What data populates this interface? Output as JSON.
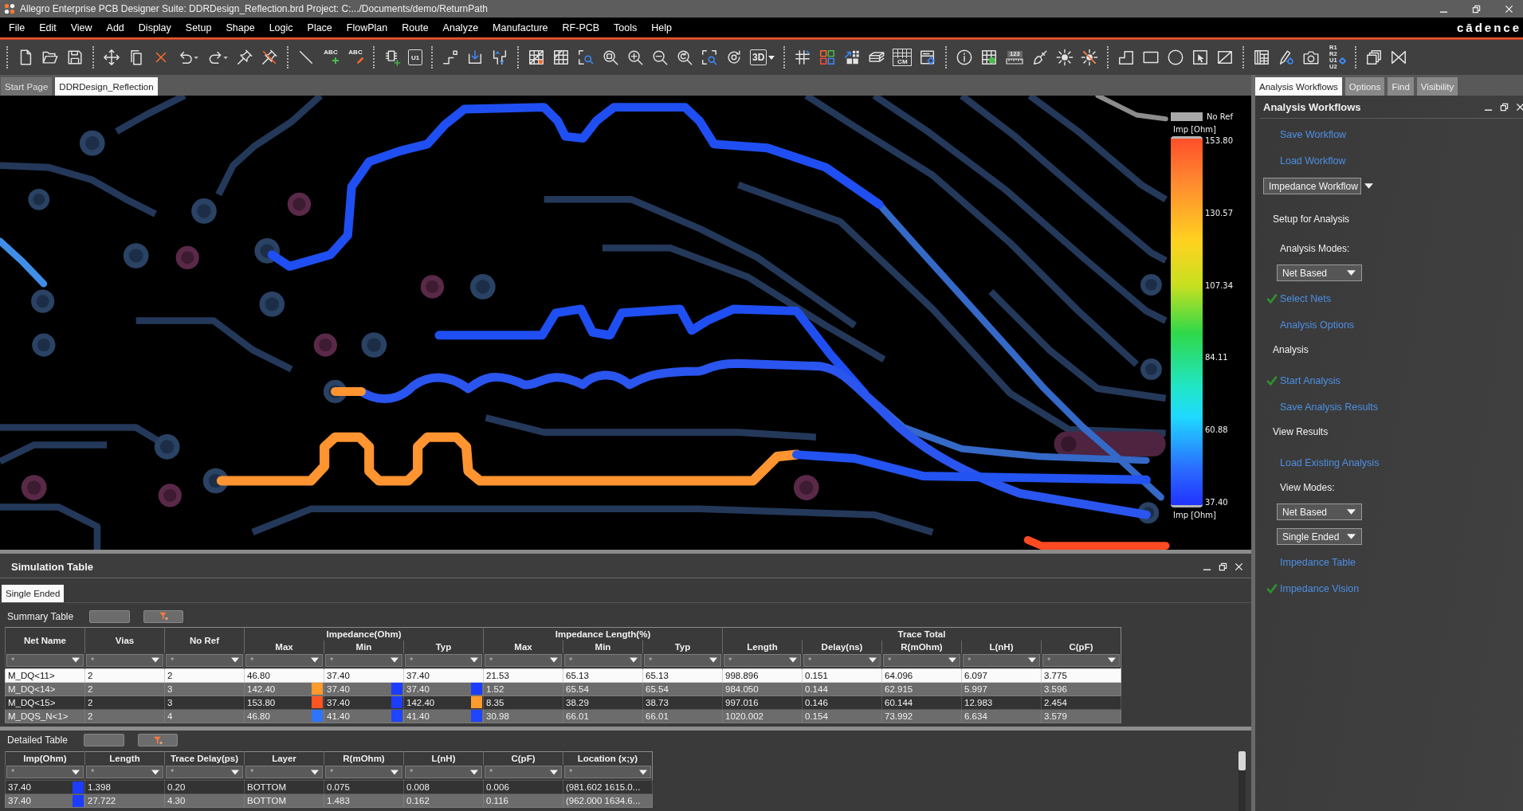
{
  "window": {
    "title": "Allegro Enterprise PCB Designer Suite: DDRDesign_Reflection.brd Project: C:.../Documents/demo/ReturnPath"
  },
  "menu": [
    "File",
    "Edit",
    "View",
    "Add",
    "Display",
    "Setup",
    "Shape",
    "Logic",
    "Place",
    "FlowPlan",
    "Route",
    "Analyze",
    "Manufacture",
    "RF-PCB",
    "Tools",
    "Help"
  ],
  "logo": "cādence",
  "toolbar": [
    [
      {
        "kind": "new"
      },
      {
        "kind": "open"
      },
      {
        "kind": "save"
      }
    ],
    [
      {
        "kind": "move"
      },
      {
        "kind": "copy"
      },
      {
        "kind": "delete"
      },
      {
        "kind": "undo"
      },
      {
        "kind": "redo"
      },
      {
        "kind": "pin"
      },
      {
        "kind": "unpin"
      }
    ],
    [
      {
        "kind": "line"
      },
      {
        "kind": "text-add",
        "text": "ABC"
      },
      {
        "kind": "text-edit",
        "text": "ABC"
      }
    ],
    [
      {
        "kind": "chip-add"
      },
      {
        "kind": "chip",
        "text": "U1"
      }
    ],
    [
      {
        "kind": "route-step"
      },
      {
        "kind": "route-drop"
      },
      {
        "kind": "route-slide"
      }
    ],
    [
      {
        "kind": "grid-mark"
      },
      {
        "kind": "grid-plain"
      },
      {
        "kind": "zoom-select"
      },
      {
        "kind": "zoom-fit"
      },
      {
        "kind": "zoom-in"
      },
      {
        "kind": "zoom-out"
      },
      {
        "kind": "zoom-prev"
      },
      {
        "kind": "zoom-area"
      },
      {
        "kind": "refresh"
      },
      {
        "kind": "view3d",
        "text": "3D"
      }
    ],
    [
      {
        "kind": "hash"
      },
      {
        "kind": "tiles"
      },
      {
        "kind": "tiles-arrow"
      },
      {
        "kind": "layers"
      },
      {
        "kind": "cm-grid",
        "text": "CM"
      },
      {
        "kind": "window-gear"
      }
    ],
    [
      {
        "kind": "info"
      },
      {
        "kind": "grid-info"
      },
      {
        "kind": "ruler",
        "text": "123"
      },
      {
        "kind": "brush"
      },
      {
        "kind": "sun"
      },
      {
        "kind": "sun-x"
      }
    ],
    [
      {
        "kind": "corner"
      },
      {
        "kind": "rect"
      },
      {
        "kind": "circle"
      },
      {
        "kind": "select-box"
      },
      {
        "kind": "diag-box"
      }
    ],
    [
      {
        "kind": "sheet"
      },
      {
        "kind": "pen-gear"
      },
      {
        "kind": "camera"
      },
      {
        "kind": "refdes",
        "text": "R1 R2 U1 U2"
      }
    ],
    [
      {
        "kind": "windows"
      },
      {
        "kind": "bowtie"
      }
    ]
  ],
  "doc_tabs": [
    {
      "label": "Start Page",
      "selected": false
    },
    {
      "label": "DDRDesign_Reflection",
      "selected": true
    }
  ],
  "legend": {
    "no_ref": "No Ref",
    "title": "Imp [Ohm]",
    "ticks": [
      "153.80",
      "130.57",
      "107.34",
      "84.11",
      "60.88",
      "37.40"
    ],
    "footer": "Imp [Ohm]"
  },
  "simulation_table": {
    "title": "Simulation Table",
    "tabs": [
      {
        "label": "Single Ended",
        "selected": true
      }
    ],
    "summary": {
      "label": "Summary Table",
      "header": [
        {
          "kind": "single",
          "label": "Net Name",
          "filter": "*"
        },
        {
          "kind": "single",
          "label": "Vias",
          "filter": "*"
        },
        {
          "kind": "single",
          "label": "No Ref",
          "filter": "*"
        },
        {
          "kind": "group",
          "label": "Impedance(Ohm)",
          "columns": [
            {
              "label": "Max",
              "filter": "*"
            },
            {
              "label": "Min",
              "filter": "*"
            },
            {
              "label": "Typ",
              "filter": "*"
            }
          ]
        },
        {
          "kind": "group",
          "label": "Impedance Length(%)",
          "columns": [
            {
              "label": "Max",
              "filter": "*"
            },
            {
              "label": "Min",
              "filter": "*"
            },
            {
              "label": "Typ",
              "filter": "*"
            }
          ]
        },
        {
          "kind": "group",
          "label": "Trace Total",
          "columns": [
            {
              "label": "Length",
              "filter": "*"
            },
            {
              "label": "Delay(ns)",
              "filter": "*"
            },
            {
              "label": "R(mOhm)",
              "filter": "*"
            },
            {
              "label": "L(nH)",
              "filter": "*"
            },
            {
              "label": "C(pF)",
              "filter": "*"
            }
          ]
        }
      ],
      "rows": [
        {
          "selected": true,
          "cells": [
            {
              "text": "M_DQ<11>"
            },
            {
              "text": "2"
            },
            {
              "text": "2"
            },
            {
              "text": "46.80"
            },
            {
              "text": "37.40"
            },
            {
              "text": "37.40"
            },
            {
              "text": "21.53"
            },
            {
              "text": "65.13"
            },
            {
              "text": "65.13"
            },
            {
              "text": "998.896"
            },
            {
              "text": "0.151"
            },
            {
              "text": "64.096"
            },
            {
              "text": "6.097"
            },
            {
              "text": "3.775"
            }
          ]
        },
        {
          "selected": false,
          "cells": [
            {
              "text": "M_DQ<14>"
            },
            {
              "text": "2"
            },
            {
              "text": "3"
            },
            {
              "text": "142.40",
              "color": "#ff9a2c"
            },
            {
              "text": "37.40",
              "color": "#1c3dff"
            },
            {
              "text": "37.40",
              "color": "#1c3dff"
            },
            {
              "text": "1.52"
            },
            {
              "text": "65.54"
            },
            {
              "text": "65.54"
            },
            {
              "text": "984.050"
            },
            {
              "text": "0.144"
            },
            {
              "text": "62.915"
            },
            {
              "text": "5.997"
            },
            {
              "text": "3.596"
            }
          ]
        },
        {
          "selected": false,
          "cells": [
            {
              "text": "M_DQ<15>"
            },
            {
              "text": "2"
            },
            {
              "text": "3"
            },
            {
              "text": "153.80",
              "color": "#ff5522"
            },
            {
              "text": "37.40",
              "color": "#1c3dff"
            },
            {
              "text": "142.40",
              "color": "#ff9a2c"
            },
            {
              "text": "8.35"
            },
            {
              "text": "38.29"
            },
            {
              "text": "38.73"
            },
            {
              "text": "997.016"
            },
            {
              "text": "0.146"
            },
            {
              "text": "60.144"
            },
            {
              "text": "12.983"
            },
            {
              "text": "2.454"
            }
          ]
        },
        {
          "selected": false,
          "cells": [
            {
              "text": "M_DQS_N<1>"
            },
            {
              "text": "2"
            },
            {
              "text": "4"
            },
            {
              "text": "46.80",
              "color": "#2f74ff"
            },
            {
              "text": "41.40",
              "color": "#1f45ff"
            },
            {
              "text": "41.40",
              "color": "#1f45ff"
            },
            {
              "text": "30.98"
            },
            {
              "text": "66.01"
            },
            {
              "text": "66.01"
            },
            {
              "text": "1020.002"
            },
            {
              "text": "0.154"
            },
            {
              "text": "73.992"
            },
            {
              "text": "6.634"
            },
            {
              "text": "3.579"
            }
          ]
        }
      ]
    },
    "detailed": {
      "label": "Detailed Table",
      "header": [
        {
          "kind": "single",
          "label": "Imp(Ohm)",
          "filter": "*"
        },
        {
          "kind": "single",
          "label": "Length",
          "filter": "*"
        },
        {
          "kind": "single",
          "label": "Trace Delay(ps)",
          "filter": "*"
        },
        {
          "kind": "single",
          "label": "Layer",
          "filter": "*"
        },
        {
          "kind": "single",
          "label": "R(mOhm)",
          "filter": "*"
        },
        {
          "kind": "single",
          "label": "L(nH)",
          "filter": "*"
        },
        {
          "kind": "single",
          "label": "C(pF)",
          "filter": "*"
        },
        {
          "kind": "single",
          "label": "Location (x;y)",
          "filter": "*"
        }
      ],
      "rows": [
        {
          "selected": false,
          "cells": [
            {
              "text": "37.40",
              "color": "#1c3dff"
            },
            {
              "text": "1.398"
            },
            {
              "text": "0.20"
            },
            {
              "text": "BOTTOM"
            },
            {
              "text": "0.075"
            },
            {
              "text": "0.008"
            },
            {
              "text": "0.006"
            },
            {
              "text": "(981.602 1615.0..."
            }
          ]
        },
        {
          "selected": false,
          "cells": [
            {
              "text": "37.40",
              "color": "#1c3dff"
            },
            {
              "text": "27.722"
            },
            {
              "text": "4.30"
            },
            {
              "text": "BOTTOM"
            },
            {
              "text": "1.483"
            },
            {
              "text": "0.162"
            },
            {
              "text": "0.116"
            },
            {
              "text": "(962.000 1634.6..."
            }
          ]
        }
      ]
    }
  },
  "panel_tabs": [
    {
      "label": "Analysis Workflows",
      "selected": true
    },
    {
      "label": "Options",
      "selected": false
    },
    {
      "label": "Find",
      "selected": false
    },
    {
      "label": "Visibility",
      "selected": false
    }
  ],
  "analysis_panel": {
    "title": "Analysis Workflows",
    "items": [
      {
        "kind": "link",
        "label": "Save Workflow",
        "checked": false
      },
      {
        "kind": "link",
        "label": "Load Workflow",
        "checked": false
      },
      {
        "kind": "dropdown",
        "value": "Impedance Workflow"
      }
    ],
    "sections": [
      {
        "heading": "Setup for Analysis",
        "items": [
          {
            "kind": "label",
            "label": "Analysis Modes:"
          },
          {
            "kind": "dropdown",
            "value": "Net Based"
          },
          {
            "kind": "link",
            "label": "Select Nets",
            "checked": true
          },
          {
            "kind": "link",
            "label": "Analysis Options",
            "checked": false
          }
        ]
      },
      {
        "heading": "Analysis",
        "items": [
          {
            "kind": "link",
            "label": "Start Analysis",
            "checked": true
          },
          {
            "kind": "link",
            "label": "Save Analysis Results",
            "checked": false
          }
        ]
      },
      {
        "heading": "View Results",
        "items": [
          {
            "kind": "link",
            "label": "Load Existing Analysis",
            "checked": false
          },
          {
            "kind": "label",
            "label": "View Modes:"
          },
          {
            "kind": "dropdown",
            "value": "Net Based"
          },
          {
            "kind": "dropdown",
            "value": "Single Ended"
          },
          {
            "kind": "link",
            "label": "Impedance Table",
            "checked": false
          },
          {
            "kind": "link",
            "label": "Impedance Vision",
            "checked": true
          }
        ]
      }
    ]
  }
}
